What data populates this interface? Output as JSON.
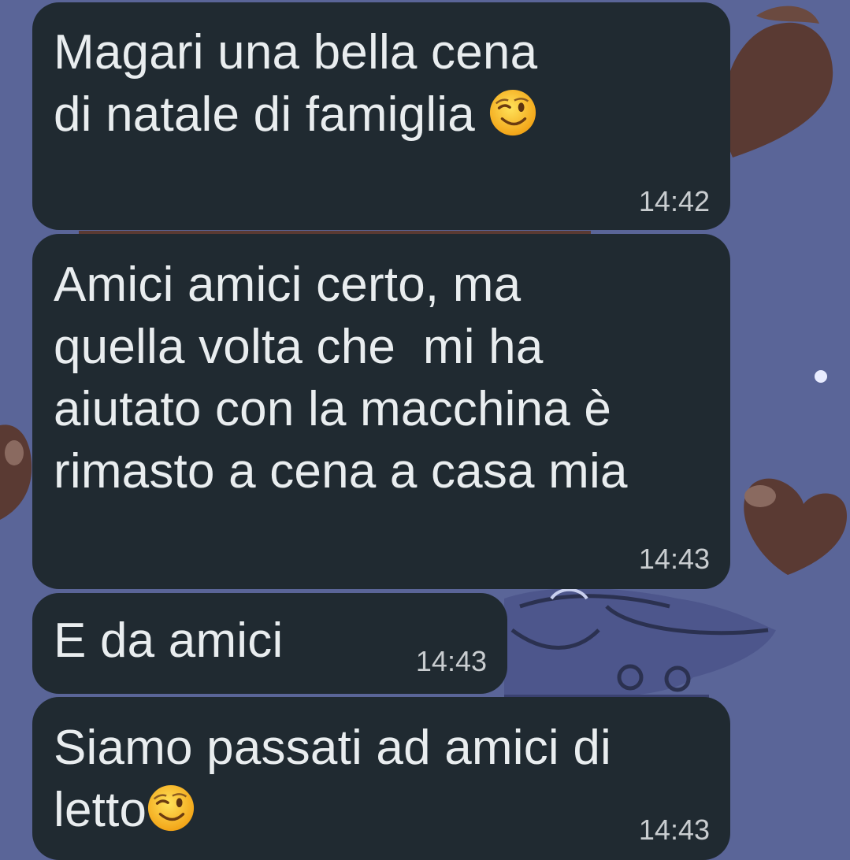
{
  "messages": [
    {
      "line1": "Magari una bella cena",
      "line2": "di natale di famiglia",
      "emoji": "winking-face",
      "time": "14:42"
    },
    {
      "line1": "Amici amici certo, ma",
      "line2": "quella volta che  mi ha",
      "line3": "aiutato con la macchina è",
      "line4": "rimasto a cena a casa mia",
      "time": "14:43"
    },
    {
      "line1": "E da amici",
      "time": "14:43"
    },
    {
      "line1": "Siamo passati ad amici di",
      "line2": "letto",
      "emoji": "winking-face",
      "time": "14:43"
    }
  ],
  "colors": {
    "wallpaper": "#5a6598",
    "bubble": "#202a31",
    "text": "#e9edef",
    "time": "#c9cdd0",
    "heart": "#5a3a33"
  }
}
